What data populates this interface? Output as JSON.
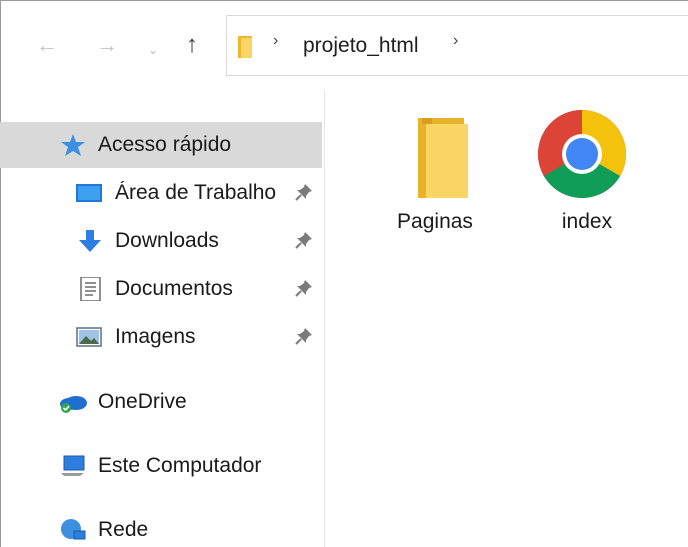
{
  "nav": {
    "back_glyph": "←",
    "forward_glyph": "→",
    "recent_glyph": "⌄",
    "up_glyph": "↑"
  },
  "address": {
    "chevron": "›",
    "crumb": "projeto_html"
  },
  "sidebar": {
    "items": [
      {
        "label": "Acesso rápido",
        "icon": "star-icon",
        "pinned": false
      },
      {
        "label": "Área de Trabalho",
        "icon": "desktop-icon",
        "pinned": true
      },
      {
        "label": "Downloads",
        "icon": "download-arrow-icon",
        "pinned": true
      },
      {
        "label": "Documentos",
        "icon": "document-icon",
        "pinned": true
      },
      {
        "label": "Imagens",
        "icon": "picture-icon",
        "pinned": true
      },
      {
        "label": "OneDrive",
        "icon": "onedrive-cloud-icon",
        "pinned": false
      },
      {
        "label": "Este Computador",
        "icon": "computer-icon",
        "pinned": false
      },
      {
        "label": "Rede",
        "icon": "network-icon",
        "pinned": false
      }
    ],
    "pin_glyph": "📌"
  },
  "files": [
    {
      "name": "Paginas",
      "icon": "folder-icon"
    },
    {
      "name": "index",
      "icon": "chrome-icon"
    }
  ],
  "colors": {
    "selection": "#d9d9d9",
    "folder": "#f5c842",
    "onedrive": "#1f6fd1",
    "download": "#2e7de0"
  }
}
